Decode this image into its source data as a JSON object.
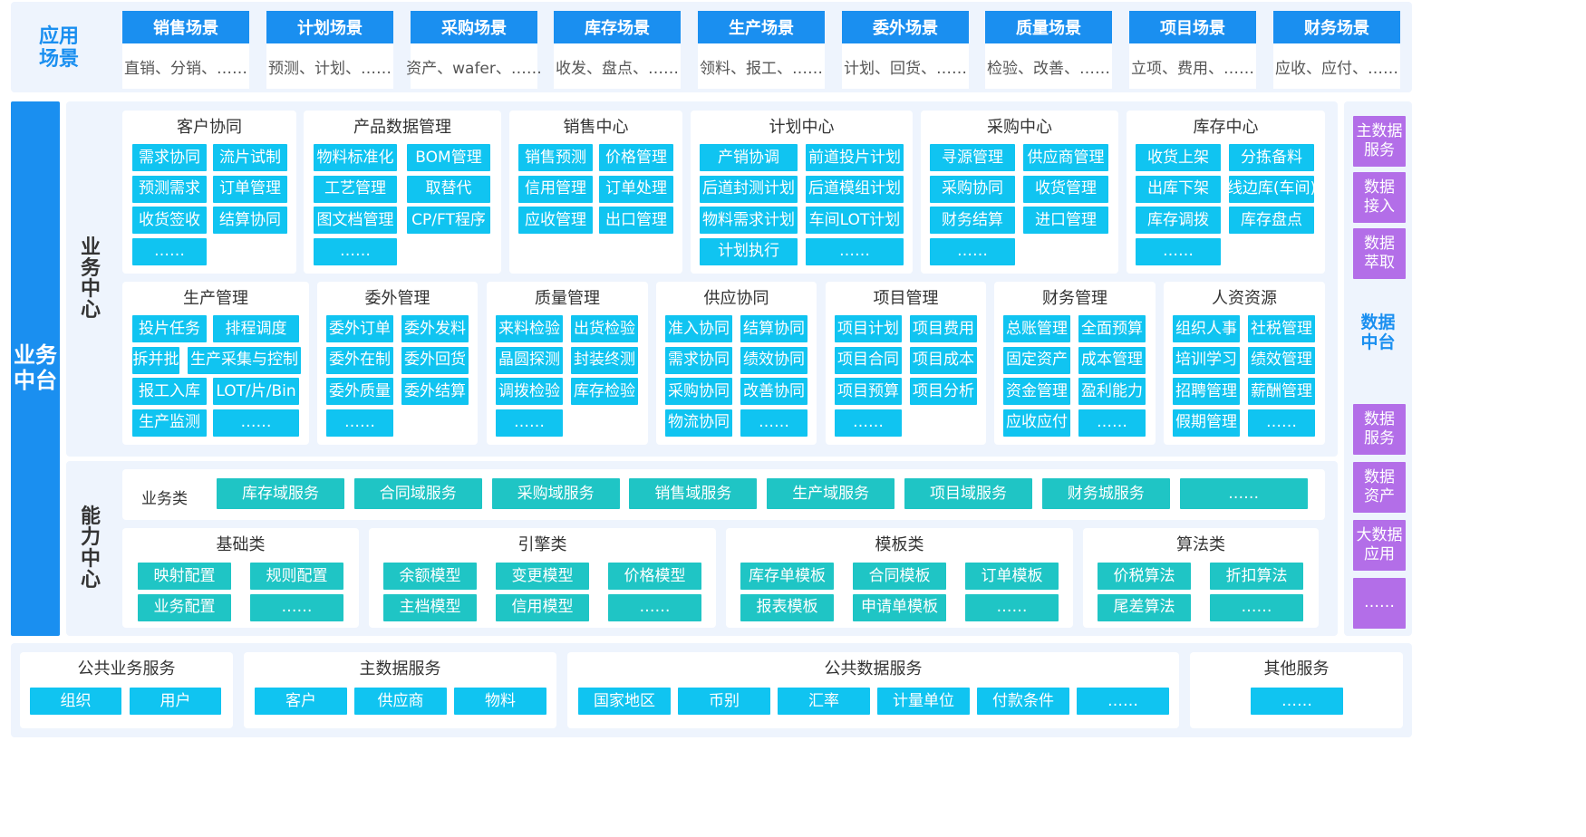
{
  "app_scene": {
    "title": "应用\n场景",
    "items": [
      {
        "title": "销售场景",
        "sub": "直销、分销、……"
      },
      {
        "title": "计划场景",
        "sub": "预测、计划、……"
      },
      {
        "title": "采购场景",
        "sub": "资产、wafer、……"
      },
      {
        "title": "库存场景",
        "sub": "收发、盘点、……"
      },
      {
        "title": "生产场景",
        "sub": "领料、报工、……"
      },
      {
        "title": "委外场景",
        "sub": "计划、回货、……"
      },
      {
        "title": "质量场景",
        "sub": "检验、改善、……"
      },
      {
        "title": "项目场景",
        "sub": "立项、费用、……"
      },
      {
        "title": "财务场景",
        "sub": "应收、应付、……"
      }
    ]
  },
  "business_platform": {
    "title": "业务\n中台"
  },
  "business_center": {
    "title": "业\n务\n中\n心",
    "modules": [
      {
        "title": "客户协同",
        "items": [
          "需求协同",
          "流片试制",
          "预测需求",
          "订单管理",
          "收货签收",
          "结算协同",
          "……"
        ]
      },
      {
        "title": "产品数据管理",
        "items": [
          "物料标准化",
          "BOM管理",
          "工艺管理",
          "取替代",
          "图文档管理",
          "CP/FT程序",
          "……"
        ]
      },
      {
        "title": "销售中心",
        "items": [
          "销售预测",
          "价格管理",
          "信用管理",
          "订单处理",
          "应收管理",
          "出口管理"
        ]
      },
      {
        "title": "计划中心",
        "items": [
          "产销协调",
          "前道投片计划",
          "后道封测计划",
          "后道模组计划",
          "物料需求计划",
          "车间LOT计划",
          "计划执行",
          "……"
        ]
      },
      {
        "title": "采购中心",
        "items": [
          "寻源管理",
          "供应商管理",
          "采购协同",
          "收货管理",
          "财务结算",
          "进口管理",
          "……"
        ]
      },
      {
        "title": "库存中心",
        "items": [
          "收货上架",
          "分拣备料",
          "出库下架",
          "线边库(车间)",
          "库存调拨",
          "库存盘点",
          "……"
        ]
      },
      {
        "title": "生产管理",
        "items": [
          "投片任务",
          "排程调度",
          "拆并批",
          "生产采集与控制",
          "报工入库",
          "LOT/片/Bin",
          "生产监测",
          "……"
        ]
      },
      {
        "title": "委外管理",
        "items": [
          "委外订单",
          "委外发料",
          "委外在制",
          "委外回货",
          "委外质量",
          "委外结算",
          "……"
        ]
      },
      {
        "title": "质量管理",
        "items": [
          "来料检验",
          "出货检验",
          "晶圆探测",
          "封装终测",
          "调拨检验",
          "库存检验",
          "……"
        ]
      },
      {
        "title": "供应协同",
        "items": [
          "准入协同",
          "结算协同",
          "需求协同",
          "绩效协同",
          "采购协同",
          "改善协同",
          "物流协同",
          "……"
        ]
      },
      {
        "title": "项目管理",
        "items": [
          "项目计划",
          "项目费用",
          "项目合同",
          "项目成本",
          "项目预算",
          "项目分析",
          "……"
        ]
      },
      {
        "title": "财务管理",
        "items": [
          "总账管理",
          "全面预算",
          "固定资产",
          "成本管理",
          "资金管理",
          "盈利能力",
          "应收应付",
          "……"
        ]
      },
      {
        "title": "人资资源",
        "items": [
          "组织人事",
          "社税管理",
          "培训学习",
          "绩效管理",
          "招聘管理",
          "薪酬管理",
          "假期管理",
          "……"
        ]
      }
    ]
  },
  "capability_center": {
    "title": "能\n力\n中\n心",
    "business_label": "业务类",
    "business_items": [
      "库存域服务",
      "合同域服务",
      "采购域服务",
      "销售域服务",
      "生产域服务",
      "项目域服务",
      "财务城服务",
      "……"
    ],
    "groups": [
      {
        "title": "基础类",
        "items": [
          "映射配置",
          "规则配置",
          "业务配置",
          "……"
        ]
      },
      {
        "title": "引擎类",
        "items": [
          "余额模型",
          "变更模型",
          "价格模型",
          "主档模型",
          "信用模型",
          "……"
        ]
      },
      {
        "title": "模板类",
        "items": [
          "库存单模板",
          "合同模板",
          "订单模板",
          "报表模板",
          "申请单模板",
          "……"
        ]
      },
      {
        "title": "算法类",
        "items": [
          "价税算法",
          "折扣算法",
          "尾差算法",
          "……"
        ]
      }
    ]
  },
  "data_platform": {
    "title": "数据\n中台",
    "top_items": [
      "主数据\n服务",
      "数据\n接入",
      "数据\n萃取"
    ],
    "bottom_items": [
      "数据\n服务",
      "数据\n资产",
      "大数据\n应用",
      "……"
    ]
  },
  "public_services": [
    {
      "title": "公共业务服务",
      "items": [
        "组织",
        "用户"
      ]
    },
    {
      "title": "主数据服务",
      "items": [
        "客户",
        "供应商",
        "物料"
      ]
    },
    {
      "title": "公共数据服务",
      "items": [
        "国家地区",
        "币别",
        "汇率",
        "计量单位",
        "付款条件",
        "……"
      ]
    },
    {
      "title": "其他服务",
      "items": [
        "……"
      ]
    }
  ],
  "colors": {
    "header_blue": "#1a8ff0",
    "chip_cyan": "#10c4f1",
    "chip_teal": "#1fc5c5",
    "chip_purple": "#b36ee8",
    "panel_bg": "#eef4fd"
  }
}
